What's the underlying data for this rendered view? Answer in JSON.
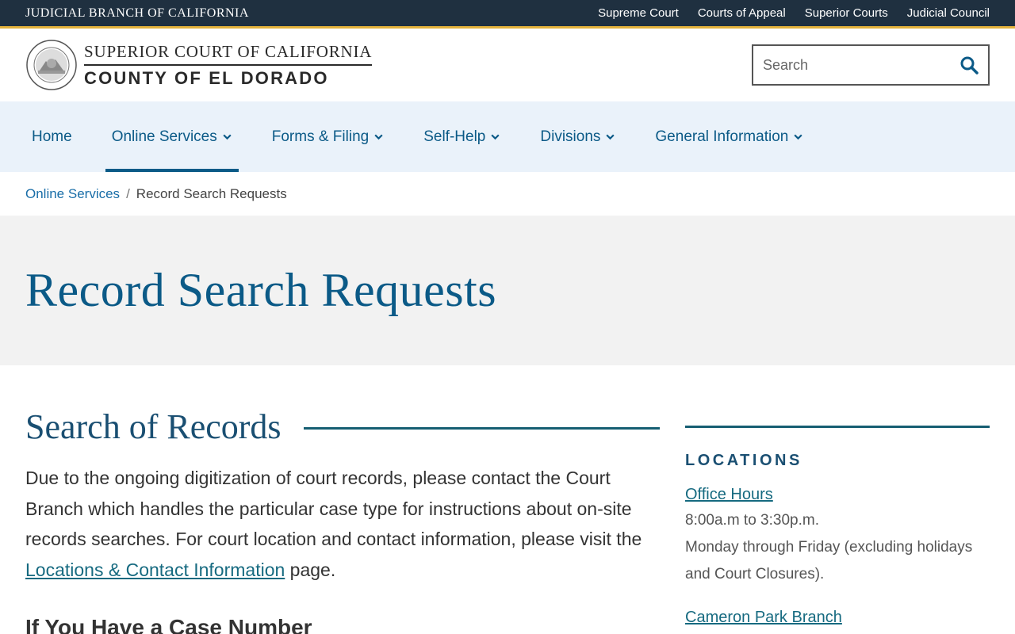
{
  "topbar": {
    "branch": "JUDICIAL BRANCH OF CALIFORNIA",
    "links": [
      "Supreme Court",
      "Courts of Appeal",
      "Superior Courts",
      "Judicial Council"
    ]
  },
  "header": {
    "line1": "SUPERIOR COURT OF CALIFORNIA",
    "line2": "COUNTY OF EL DORADO",
    "search_placeholder": "Search"
  },
  "nav": {
    "items": [
      {
        "label": "Home"
      },
      {
        "label": "Online Services"
      },
      {
        "label": "Forms & Filing"
      },
      {
        "label": "Self-Help"
      },
      {
        "label": "Divisions"
      },
      {
        "label": "General Information"
      }
    ]
  },
  "breadcrumb": {
    "parent": "Online Services",
    "separator": "/",
    "current": "Record Search Requests"
  },
  "hero": {
    "title": "Record Search Requests"
  },
  "main": {
    "section_title": "Search of Records",
    "para_text": "Due to the ongoing digitization of court records, please contact the Court Branch which handles the particular case type for instructions about on-site records searches.   For court location and contact information, please visit the ",
    "para_link": "Locations & Contact Information",
    "para_end": " page.",
    "subhead": "If You Have a Case Number"
  },
  "sidebar": {
    "heading": "LOCATIONS",
    "office_hours_link": "Office Hours",
    "hours": "8:00a.m to 3:30p.m.",
    "days": "Monday through Friday (excluding holidays and Court Closures).",
    "branch_link": "Cameron Park Branch"
  },
  "colors": {
    "topbar_bg": "#1f3040",
    "topbar_accent": "#e3b23c",
    "primary_blue": "#0b5a87",
    "nav_bg": "#eaf2fa",
    "teal_rule": "#165e72"
  }
}
